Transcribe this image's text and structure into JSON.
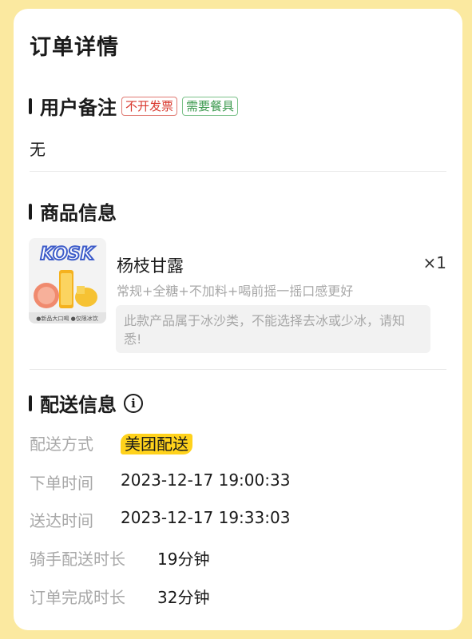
{
  "page_title": "订单详情",
  "remarks": {
    "title": "用户备注",
    "tags": [
      "不开发票",
      "需要餐具"
    ],
    "content": "无"
  },
  "product": {
    "section_title": "商品信息",
    "name": "杨枝甘露",
    "quantity": "×1",
    "spec": "常规+全糖+不加料+喝前摇一摇口感更好",
    "note": "此款产品属于冰沙类，不能选择去冰或少冰，请知悉!",
    "image_label": "●新品大口喝  ●仅限冰饮"
  },
  "delivery": {
    "section_title": "配送信息",
    "info_icon": "info-icon",
    "rows": [
      {
        "label": "配送方式",
        "value": "美团配送"
      },
      {
        "label": "下单时间",
        "value": "2023-12-17 19:00:33"
      },
      {
        "label": "送达时间",
        "value": "2023-12-17 19:33:03"
      },
      {
        "label": "骑手配送时长",
        "value": "19分钟"
      },
      {
        "label": "订单完成时长",
        "value": "32分钟"
      }
    ]
  },
  "colors": {
    "background": "#fbe9a0",
    "delivery_badge": "#ffd21c",
    "tag_red": "#d9382e",
    "tag_green": "#3d9a4f"
  }
}
